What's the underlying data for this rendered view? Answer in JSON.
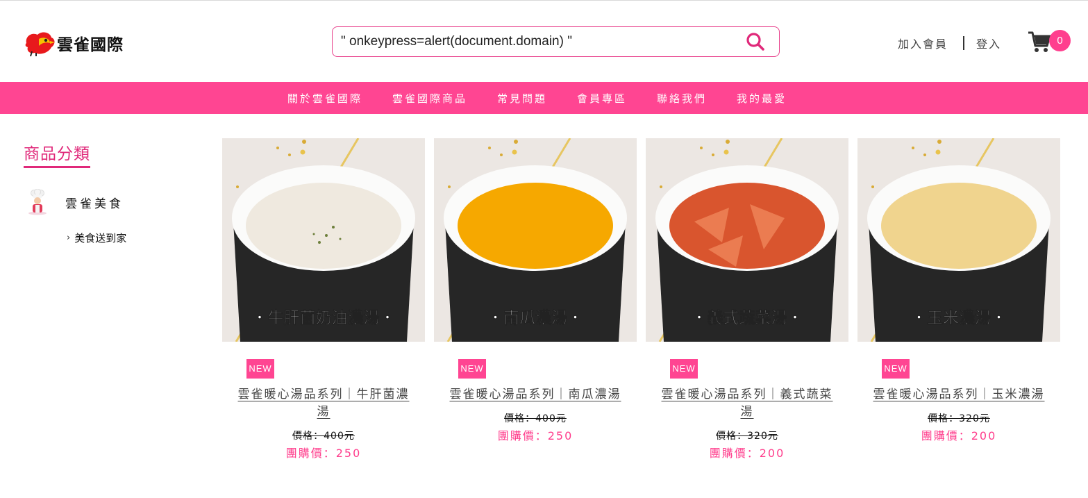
{
  "header": {
    "brand": "雲雀國際",
    "search_value": "\" onkeypress=alert(document.domain) \"",
    "join_label": "加入會員",
    "login_label": "登入",
    "cart_count": "0"
  },
  "nav": {
    "items": [
      {
        "label": "關於雲雀國際"
      },
      {
        "label": "雲雀國際商品"
      },
      {
        "label": "常見問題"
      },
      {
        "label": "會員專區"
      },
      {
        "label": "聯絡我們"
      },
      {
        "label": "我的最愛"
      }
    ]
  },
  "sidebar": {
    "title": "商品分類",
    "category": "雲雀美食",
    "subcategory": "美食送到家"
  },
  "products": [
    {
      "image_caption": "・牛肝菌奶油濃湯・",
      "soup_color": "#efe9df",
      "badge": "NEW",
      "name": "雲雀暖心湯品系列｜牛肝菌濃湯",
      "price": "價格：400元",
      "group_price": "團購價：250"
    },
    {
      "image_caption": "・南瓜濃湯・",
      "soup_color": "#f6a800",
      "badge": "NEW",
      "name": "雲雀暖心湯品系列｜南瓜濃湯",
      "price": "價格：400元",
      "group_price": "團購價：250"
    },
    {
      "image_caption": "・義式蔬菜湯・",
      "soup_color": "#d9552e",
      "badge": "NEW",
      "name": "雲雀暖心湯品系列｜義式蔬菜湯",
      "price": "價格：320元",
      "group_price": "團購價：200"
    },
    {
      "image_caption": "・玉米濃湯・",
      "soup_color": "#f0d48e",
      "badge": "NEW",
      "name": "雲雀暖心湯品系列｜玉米濃湯",
      "price": "價格：320元",
      "group_price": "團購價：200"
    }
  ],
  "colors": {
    "accent": "#ff4592",
    "price_accent": "#ff3d8c"
  },
  "icons": {
    "search": "search-icon",
    "cart": "cart-icon",
    "chevron": "chevron-right-icon"
  }
}
